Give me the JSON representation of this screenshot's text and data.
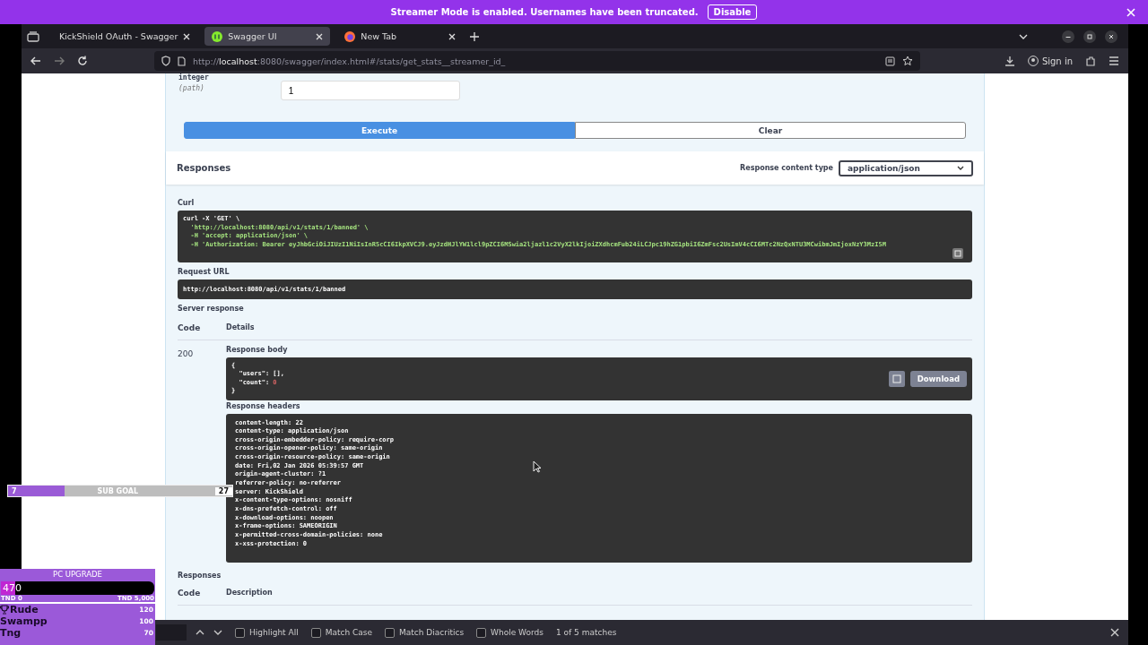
{
  "banner": {
    "text": "Streamer Mode is enabled. Usernames have been truncated.",
    "button": "Disable"
  },
  "tabs": [
    {
      "title": "KickShield OAuth - Swagger",
      "kind": "plain",
      "selected": false
    },
    {
      "title": "Swagger UI",
      "kind": "swagger",
      "selected": true
    },
    {
      "title": "New Tab",
      "kind": "browser",
      "selected": false
    }
  ],
  "address": "http://**localhost**:8080/swagger/index.html#/stats/get_stats__streamer_id_",
  "sign_in": "Sign in",
  "param": {
    "type": "integer",
    "location": "(path)",
    "value": "1"
  },
  "execute": "Execute",
  "clear": "Clear",
  "responses_title": "Responses",
  "content_type_label": "Response content type",
  "content_type": "application/json",
  "curl_label": "Curl",
  "curl_lines": [
    "curl -X 'GET' \\",
    "  'http://localhost:8080/api/v1/stats/1/banned' \\",
    "  -H 'accept: application/json' \\",
    "  -H 'Authorization: Bearer eyJhbGciOiJIUzI1NiIsInR5cCI6IkpXVCJ9.eyJzdHJlYW1lcl9pZCI6MSwia2ljazl1c2VyX2lkIjoiZXdhcmFub24iLCJpc19hZG1pbiI6ZmFsc2UsImV4cCI6MTc2NzQxNTU3MCwibmJmIjoxNzY3MzI5M"
  ],
  "request_url_label": "Request URL",
  "request_url": "http://localhost:8080/api/v1/stats/1/banned",
  "server_response_label": "Server response",
  "columns": [
    "Code",
    "Details"
  ],
  "code": "200",
  "body_label": "Response body",
  "body_lines": [
    {
      "text": "{"
    },
    {
      "text": "  \"users\": [],"
    },
    {
      "text": "  \"count\": ",
      "value": "0"
    },
    {
      "text": "}"
    }
  ],
  "download": "Download",
  "headers_label": "Response headers",
  "headers": [
    "content-length: 22",
    "content-type: application/json",
    "cross-origin-embedder-policy: require-corp",
    "cross-origin-opener-policy: same-origin",
    "cross-origin-resource-policy: same-origin",
    "date: Fri,02 Jan 2026 05:39:57 GMT",
    "origin-agent-cluster: ?1",
    "referrer-policy: no-referrer",
    "server: KickShield",
    "x-content-type-options: nosniff",
    "x-dns-prefetch-control: off",
    "x-download-options: noopen",
    "x-frame-options: SAMEORIGIN",
    "x-permitted-cross-domain-policies: none",
    "x-xss-protection: 0"
  ],
  "responses2_title": "Responses",
  "columns2": [
    "Code",
    "Description"
  ],
  "find_options": [
    {
      "label": "Highlight All",
      "checked": false
    },
    {
      "label": "Match Case",
      "checked": false
    },
    {
      "label": "Match Diacritics",
      "checked": false
    },
    {
      "label": "Whole Words",
      "checked": false
    }
  ],
  "find_status": "1 of 5 matches",
  "sub_goal": {
    "current": "7",
    "label": "SUB GOAL",
    "target": "27",
    "level": 0.25
  },
  "pc_upgrade": {
    "title": "PC UPGRADE",
    "amount": "470",
    "level": 0.094,
    "min": "TND 0",
    "max": "TND 5,000",
    "leaders": [
      {
        "name": "Rude",
        "score": "120",
        "kind": "top"
      },
      {
        "name": "Swampp",
        "score": "100",
        "kind": "plain"
      },
      {
        "name": "Tng",
        "score": "70",
        "kind": "plain"
      }
    ]
  }
}
